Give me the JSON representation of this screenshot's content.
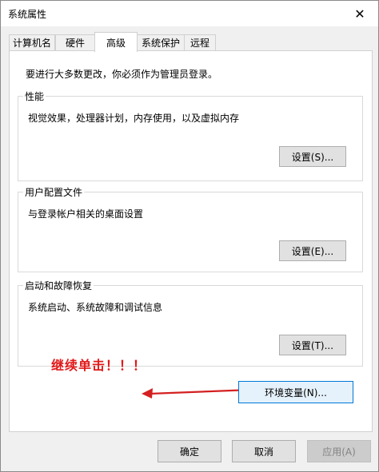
{
  "window": {
    "title": "系统属性",
    "close_glyph": "✕"
  },
  "tabs": [
    {
      "label": "计算机名",
      "active": false
    },
    {
      "label": "硬件",
      "active": false
    },
    {
      "label": "高级",
      "active": true
    },
    {
      "label": "系统保护",
      "active": false
    },
    {
      "label": "远程",
      "active": false
    }
  ],
  "panel": {
    "intro": "要进行大多数更改，你必须作为管理员登录。",
    "performance": {
      "legend": "性能",
      "description": "视觉效果，处理器计划，内存使用，以及虚拟内存",
      "button": "设置(S)..."
    },
    "user_profiles": {
      "legend": "用户配置文件",
      "description": "与登录帐户相关的桌面设置",
      "button": "设置(E)..."
    },
    "startup_recovery": {
      "legend": "启动和故障恢复",
      "description": "系统启动、系统故障和调试信息",
      "button": "设置(T)..."
    },
    "env_button": "环境变量(N)...",
    "annotation": "继续单击！！！"
  },
  "footer": {
    "ok": "确定",
    "cancel": "取消",
    "apply": "应用(A)"
  },
  "colors": {
    "annotation": "#e11919",
    "focus_border": "#0078d7"
  },
  "icons": {
    "close": "close-icon",
    "arrow": "arrow-left-icon"
  }
}
